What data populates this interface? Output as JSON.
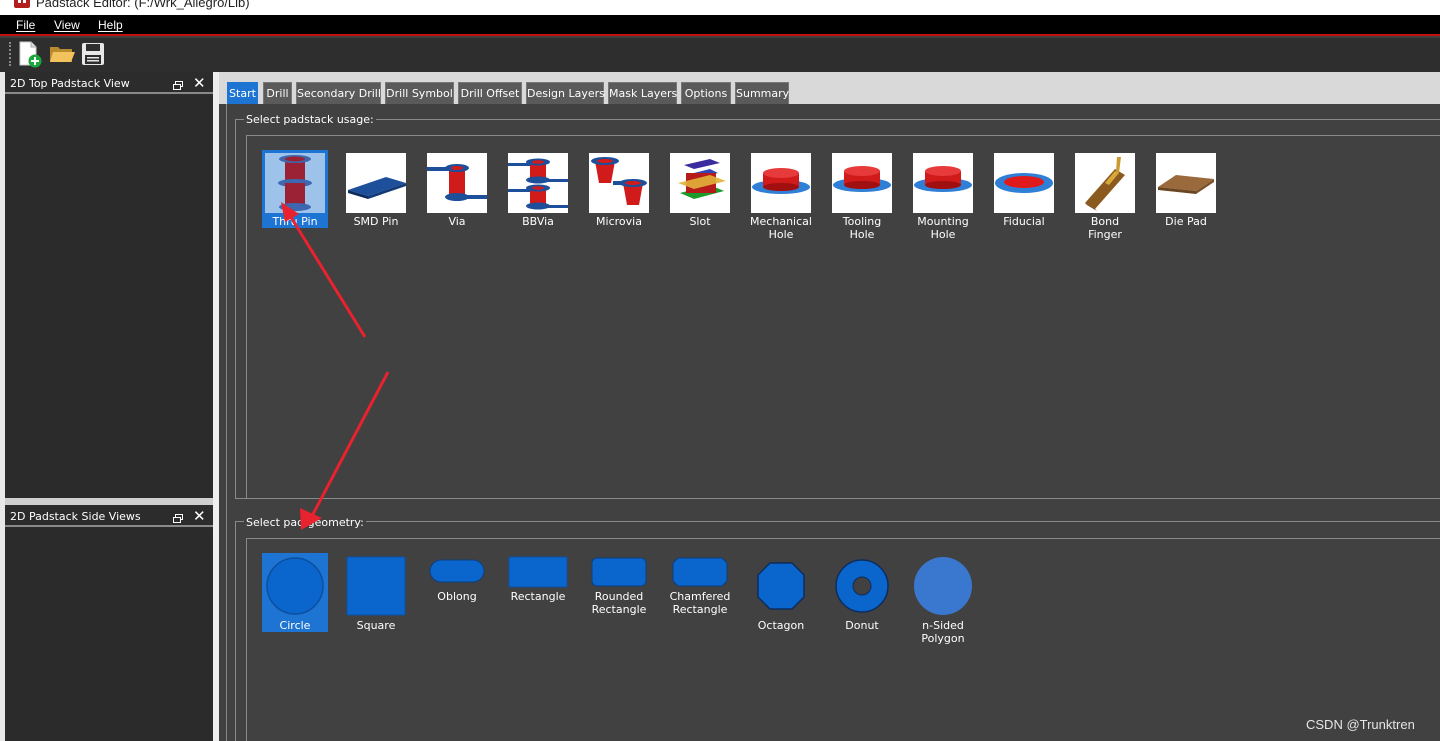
{
  "window": {
    "title": "Padstack Editor:  (F:/Wrk_Allegro/Lib)"
  },
  "menu": {
    "items": [
      "File",
      "View",
      "Help"
    ]
  },
  "toolbar": {
    "buttons": [
      "new-padstack-icon",
      "open-folder-icon",
      "save-icon"
    ]
  },
  "panels": {
    "top_view": {
      "title": "2D Top Padstack View"
    },
    "side_views": {
      "title": "2D Padstack Side Views"
    }
  },
  "tabs": [
    "Start",
    "Drill",
    "Secondary Drill",
    "Drill Symbol",
    "Drill Offset",
    "Design Layers",
    "Mask Layers",
    "Options",
    "Summary"
  ],
  "active_tab": "Start",
  "usage": {
    "title": "Select padstack usage:",
    "selected": "Thru Pin",
    "items": [
      {
        "label": "Thru Pin",
        "icon": "thru-pin-icon"
      },
      {
        "label": "SMD Pin",
        "icon": "smd-pin-icon"
      },
      {
        "label": "Via",
        "icon": "via-icon"
      },
      {
        "label": "BBVia",
        "icon": "bbvia-icon"
      },
      {
        "label": "Microvia",
        "icon": "microvia-icon"
      },
      {
        "label": "Slot",
        "icon": "slot-icon"
      },
      {
        "label": "Mechanical\nHole",
        "icon": "mechanical-hole-icon"
      },
      {
        "label": "Tooling\nHole",
        "icon": "tooling-hole-icon"
      },
      {
        "label": "Mounting\nHole",
        "icon": "mounting-hole-icon"
      },
      {
        "label": "Fiducial",
        "icon": "fiducial-icon"
      },
      {
        "label": "Bond\nFinger",
        "icon": "bond-finger-icon"
      },
      {
        "label": "Die Pad",
        "icon": "die-pad-icon"
      }
    ]
  },
  "geometry": {
    "title": "Select pad geometry:",
    "selected": "Circle",
    "items": [
      {
        "label": "Circle",
        "icon": "circle-shape-icon"
      },
      {
        "label": "Square",
        "icon": "square-shape-icon"
      },
      {
        "label": "Oblong",
        "icon": "oblong-shape-icon"
      },
      {
        "label": "Rectangle",
        "icon": "rectangle-shape-icon"
      },
      {
        "label": "Rounded\nRectangle",
        "icon": "rounded-rectangle-shape-icon"
      },
      {
        "label": "Chamfered\nRectangle",
        "icon": "chamfered-rectangle-shape-icon"
      },
      {
        "label": "Octagon",
        "icon": "octagon-shape-icon"
      },
      {
        "label": "Donut",
        "icon": "donut-shape-icon"
      },
      {
        "label": "n-Sided\nPolygon",
        "icon": "n-sided-polygon-shape-icon"
      }
    ]
  },
  "watermark": "CSDN @Trunktren",
  "colors": {
    "accent": "#1e74d2",
    "pad_blue": "#0a66cc",
    "annotation_arrow": "#e8222e"
  }
}
